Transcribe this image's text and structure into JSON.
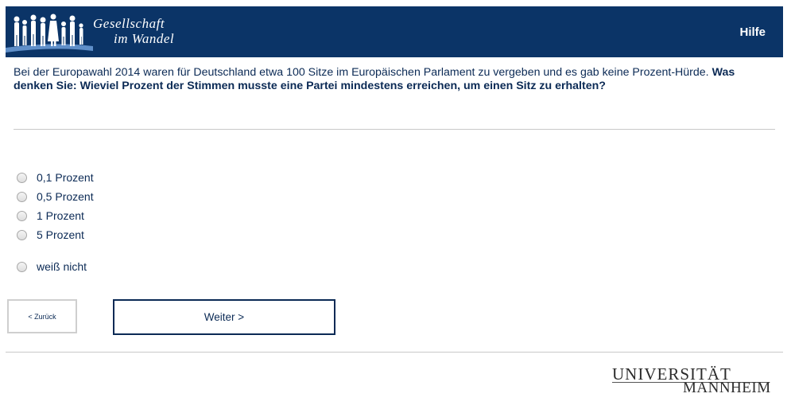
{
  "header": {
    "brand_line1": "Gesellschaft",
    "brand_line2": "im Wandel",
    "help_label": "Hilfe"
  },
  "question": {
    "intro": "Bei der Europawahl 2014 waren für Deutschland etwa 100 Sitze im Europäischen Parlament zu vergeben und es gab keine Prozent-Hürde.",
    "prompt": "Was denken Sie: Wieviel Prozent der Stimmen musste eine Partei mindestens erreichen, um einen Sitz zu erhalten?"
  },
  "options": [
    {
      "label": "0,1 Prozent",
      "selected": false
    },
    {
      "label": "0,5 Prozent",
      "selected": false
    },
    {
      "label": "1 Prozent",
      "selected": false
    },
    {
      "label": "5 Prozent",
      "selected": false
    },
    {
      "label": "weiß nicht",
      "selected": false
    }
  ],
  "nav": {
    "back_label": "< Zurück",
    "next_label": "Weiter >"
  },
  "footer": {
    "uni_line1": "UNIVERSITÄT",
    "uni_line2": "MANNHEIM"
  },
  "colors": {
    "header_bg": "#0b3467",
    "text": "#0b2a55"
  }
}
